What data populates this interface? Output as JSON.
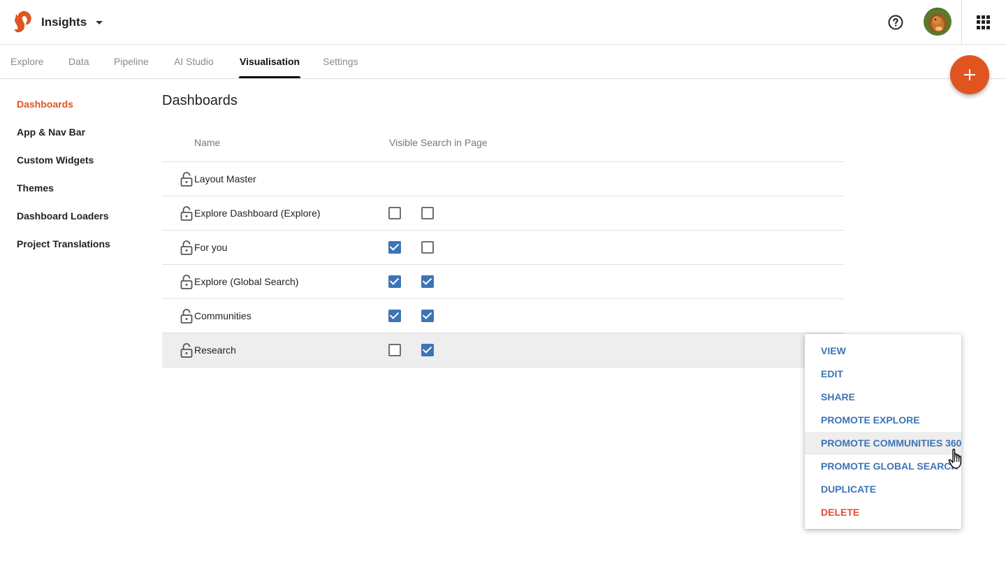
{
  "header": {
    "app_title": "Insights"
  },
  "tabs": [
    {
      "label": "Explore"
    },
    {
      "label": "Data"
    },
    {
      "label": "Pipeline"
    },
    {
      "label": "AI Studio"
    },
    {
      "label": "Visualisation",
      "active": true
    },
    {
      "label": "Settings"
    }
  ],
  "sidebar": {
    "items": [
      {
        "label": "Dashboards",
        "active": true
      },
      {
        "label": "App & Nav Bar"
      },
      {
        "label": "Custom Widgets"
      },
      {
        "label": "Themes"
      },
      {
        "label": "Dashboard Loaders"
      },
      {
        "label": "Project Translations"
      }
    ]
  },
  "main": {
    "title": "Dashboards",
    "columns": {
      "name": "Name",
      "visible": "Visible Search in Page"
    },
    "rows": [
      {
        "name": "Layout Master",
        "checks": []
      },
      {
        "name": "Explore Dashboard (Explore)",
        "checks": [
          false,
          false
        ]
      },
      {
        "name": "For you",
        "checks": [
          true,
          false
        ]
      },
      {
        "name": "Explore (Global Search)",
        "checks": [
          true,
          true
        ]
      },
      {
        "name": "Communities",
        "checks": [
          true,
          true
        ]
      },
      {
        "name": "Research",
        "checks": [
          false,
          true
        ],
        "selected": true
      }
    ]
  },
  "context_menu": {
    "items": [
      {
        "label": "VIEW"
      },
      {
        "label": "EDIT"
      },
      {
        "label": "SHARE"
      },
      {
        "label": "PROMOTE EXPLORE"
      },
      {
        "label": "PROMOTE COMMUNITIES 360",
        "hover": true
      },
      {
        "label": "PROMOTE GLOBAL SEARCH"
      },
      {
        "label": "DUPLICATE"
      },
      {
        "label": "DELETE",
        "danger": true
      }
    ]
  },
  "colors": {
    "accent": "#e0541f",
    "link": "#3d74b6",
    "danger": "#e04a36",
    "checkbox_checked": "#3d74b6",
    "row_selected_bg": "#eeeeee"
  },
  "icons": {
    "logo": "squirrel-logo-icon",
    "dropdown": "caret-down-icon",
    "help": "help-circle-icon",
    "apps": "apps-grid-icon",
    "add": "plus-icon",
    "lock": "lock-icon",
    "cursor": "hand-pointer-icon"
  }
}
